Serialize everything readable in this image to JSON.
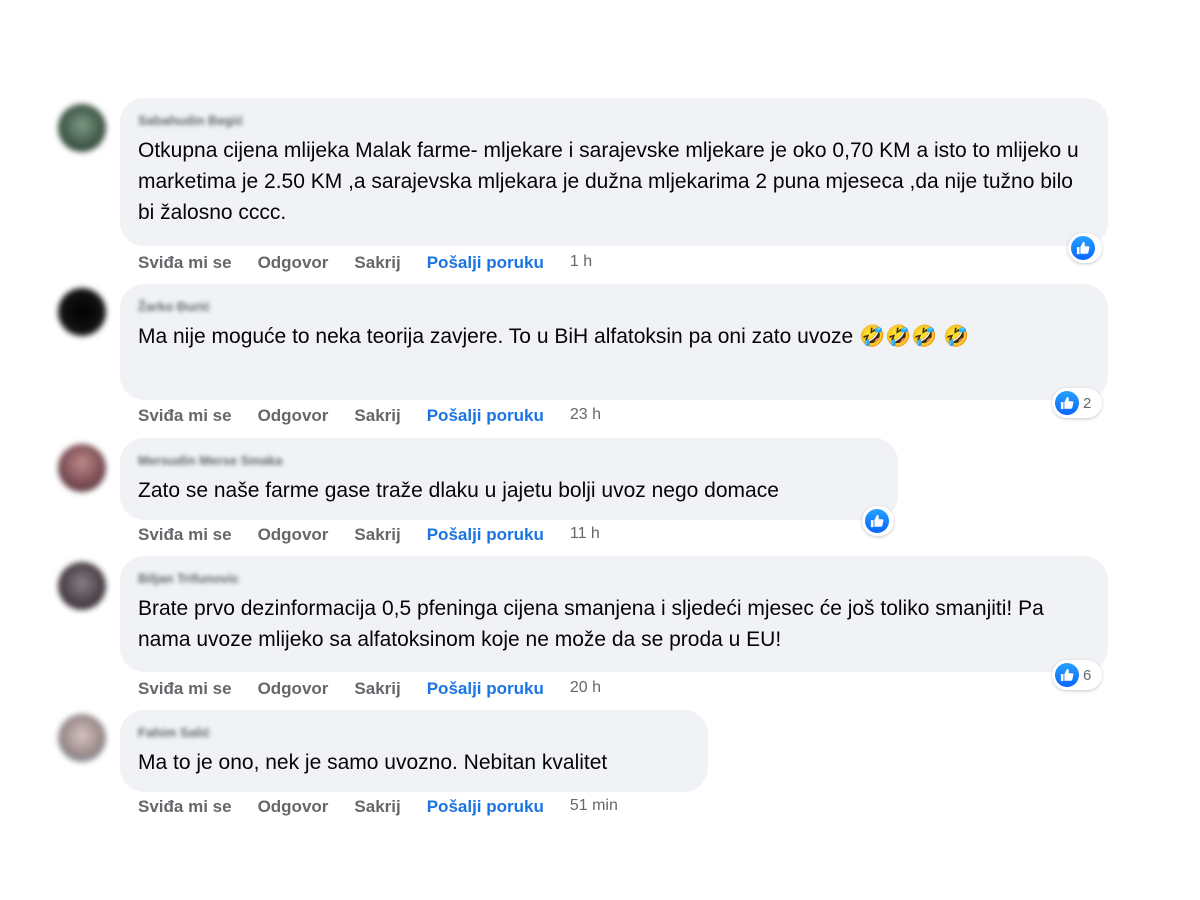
{
  "actions": {
    "like": "Sviđa mi se",
    "reply": "Odgovor",
    "hide": "Sakrij",
    "send_message": "Pošalji poruku"
  },
  "comments": [
    {
      "author": "Sabahudin Begić",
      "text": "Otkupna cijena mlijeka Malak farme- mljekare i sarajevske mljekare je oko 0,70 KM a isto to mlijeko u marketima je 2.50 KM ,a sarajevska mljekara je dužna mljekarima 2 puna mjeseca ,da nije tužno bilo bi žalosno cccc.",
      "time": "1 h",
      "reactions": ""
    },
    {
      "author": "Žarko Đurić",
      "text": "Ma nije moguće to neka teorija zavjere. To u BiH alfatoksin pa oni zato uvoze 🤣🤣🤣 🤣",
      "time": "23 h",
      "reactions": "2"
    },
    {
      "author": "Mersudin Merse Smaka",
      "text": "Zato se naše farme gase traže dlaku u jajetu bolji uvoz nego domace",
      "time": "11 h",
      "reactions": ""
    },
    {
      "author": "Biljan Trifunovic",
      "text": "Brate prvo dezinformacija 0,5 pfeninga cijena smanjena i sljedeći mjesec će još toliko smanjiti! Pa nama uvoze mlijeko sa alfatoksinom koje ne može da se proda u EU!",
      "time": "20 h",
      "reactions": "6"
    },
    {
      "author": "Fahim Salić",
      "text": "Ma to je ono, nek je samo uvozno. Nebitan kvalitet",
      "time": "51 min",
      "reactions": ""
    }
  ],
  "colors": {
    "bubble": "#f0f2f5",
    "action_text": "#65676b",
    "link_blue": "#1b74e4",
    "like_blue": "#0866ff"
  }
}
